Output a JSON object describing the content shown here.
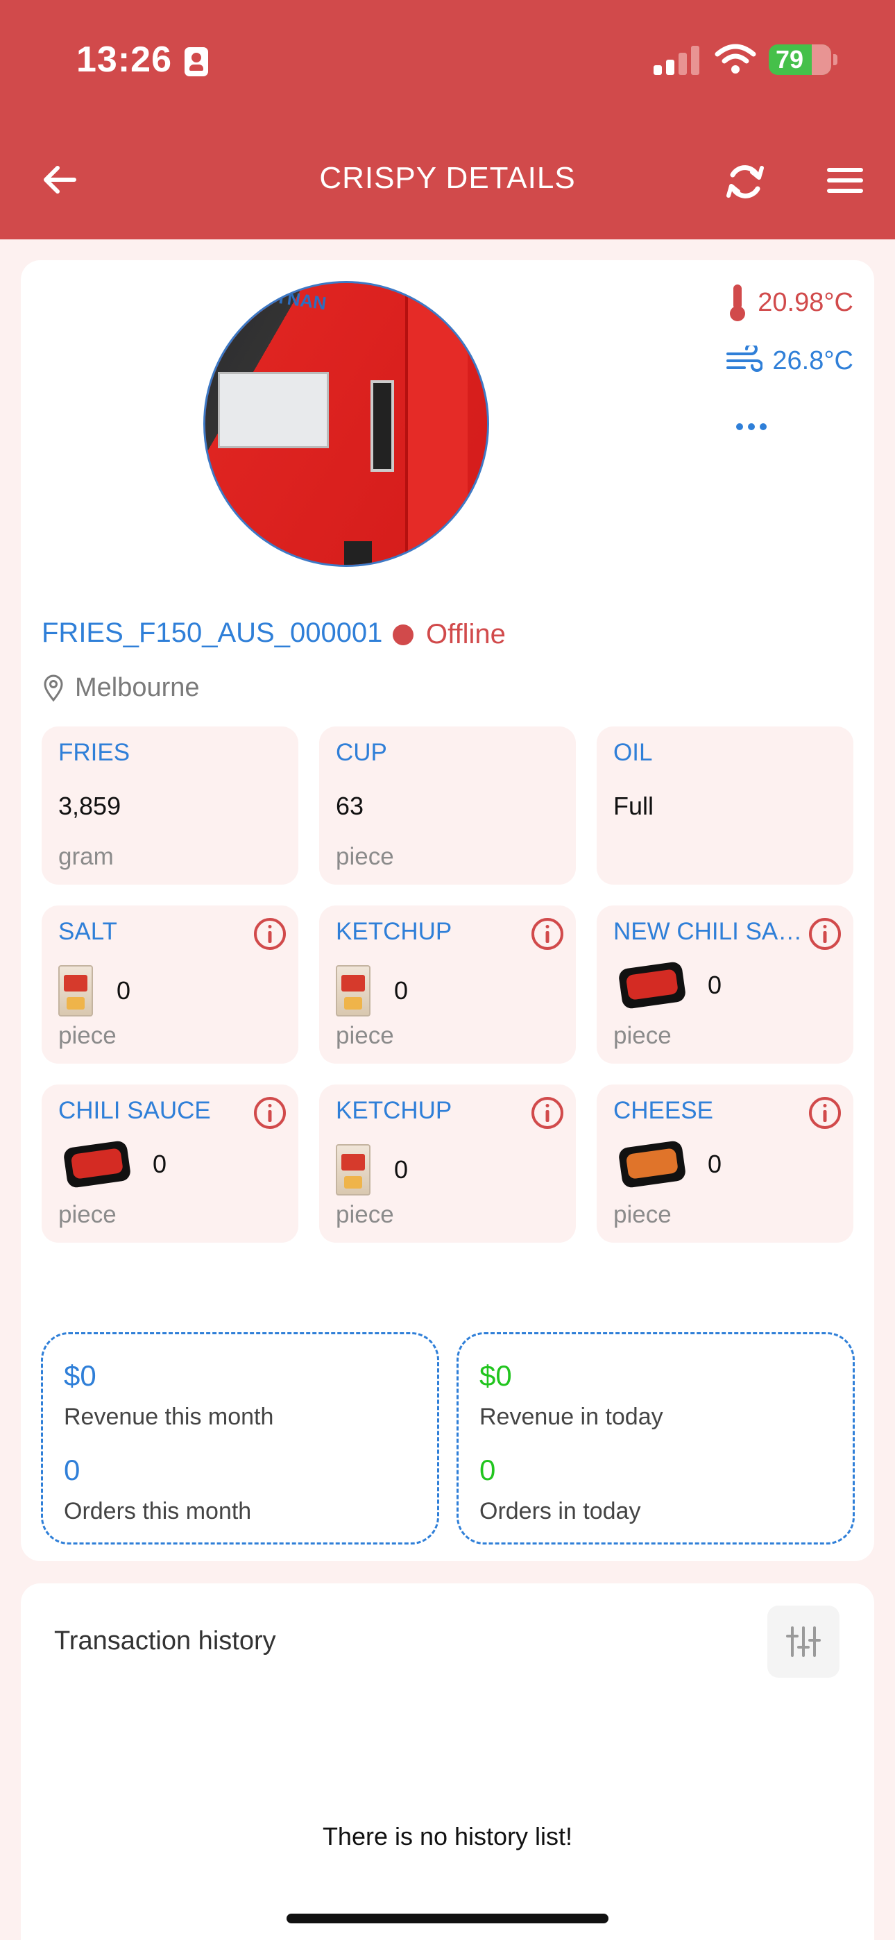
{
  "status_bar": {
    "time": "13:26",
    "battery": "79"
  },
  "header": {
    "title": "CRISPY DETAILS"
  },
  "device": {
    "image_brand": "HYNAN",
    "temperature": "20.98°C",
    "wind_temp": "26.8°C",
    "machine_id": "FRIES_F150_AUS_000001",
    "status": "Offline",
    "location": "Melbourne"
  },
  "inventory": [
    {
      "label": "FRIES",
      "value": "3,859",
      "unit": "gram"
    },
    {
      "label": "CUP",
      "value": "63",
      "unit": "piece"
    },
    {
      "label": "OIL",
      "value": "Full",
      "unit": ""
    }
  ],
  "products": [
    {
      "label": "SALT",
      "count": "0",
      "unit": "piece",
      "icon": "sachet-icon"
    },
    {
      "label": "KETCHUP",
      "count": "0",
      "unit": "piece",
      "icon": "sachet-icon"
    },
    {
      "label": "NEW CHILI SAUCE",
      "count": "0",
      "unit": "piece",
      "icon": "sauce-tub-icon"
    },
    {
      "label": "CHILI SAUCE",
      "count": "0",
      "unit": "piece",
      "icon": "sauce-tub-icon"
    },
    {
      "label": "KETCHUP",
      "count": "0",
      "unit": "piece",
      "icon": "sachet-icon"
    },
    {
      "label": "CHEESE",
      "count": "0",
      "unit": "piece",
      "icon": "cheese-tub-icon"
    }
  ],
  "stats": {
    "month": {
      "revenue": "$0",
      "revenue_label": "Revenue this month",
      "orders": "0",
      "orders_label": "Orders this month"
    },
    "today": {
      "revenue": "$0",
      "revenue_label": "Revenue in today",
      "orders": "0",
      "orders_label": "Orders in today"
    }
  },
  "history": {
    "title": "Transaction history",
    "empty_message": "There is no history list!"
  },
  "colors": {
    "primary": "#d14a4b",
    "accent_blue": "#2f7fd8",
    "accent_green": "#22c51f",
    "tile_bg": "#fdf1f0"
  }
}
